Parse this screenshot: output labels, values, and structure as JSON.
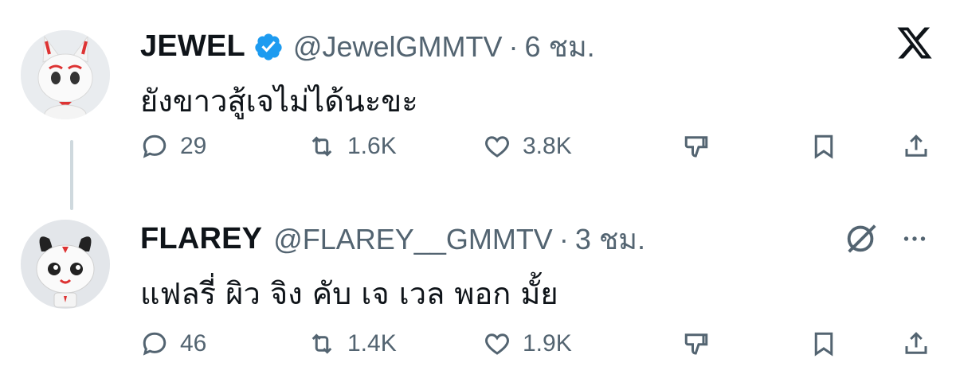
{
  "tweets": [
    {
      "name": "JEWEL",
      "handle": "@JewelGMMTV",
      "dot": "·",
      "time": "6 ชม.",
      "text": "ยังขาวสู้เจไม่ได้นะขะ",
      "actions": {
        "replies": "29",
        "retweets": "1.6K",
        "likes": "3.8K"
      },
      "verified": true
    },
    {
      "name": "FLAREY",
      "handle": "@FLAREY__GMMTV",
      "dot": "·",
      "time": "3 ชม.",
      "text": "แฟลรี่ ผิว จิง คับ เจ เวล พอก มั้ย",
      "actions": {
        "replies": "46",
        "retweets": "1.4K",
        "likes": "1.9K"
      },
      "verified": false
    }
  ],
  "icons": {
    "reply": "reply-icon",
    "retweet": "retweet-icon",
    "like": "heart-icon",
    "dislike": "dislike-icon",
    "bookmark": "bookmark-icon",
    "share": "share-icon",
    "x_logo": "x-logo-icon",
    "grok": "grok-icon",
    "more": "more-icon"
  },
  "colors": {
    "verified": "#1d9bf0",
    "muted": "#536471",
    "text": "#0f1419",
    "thread_line": "#cfd9de"
  }
}
